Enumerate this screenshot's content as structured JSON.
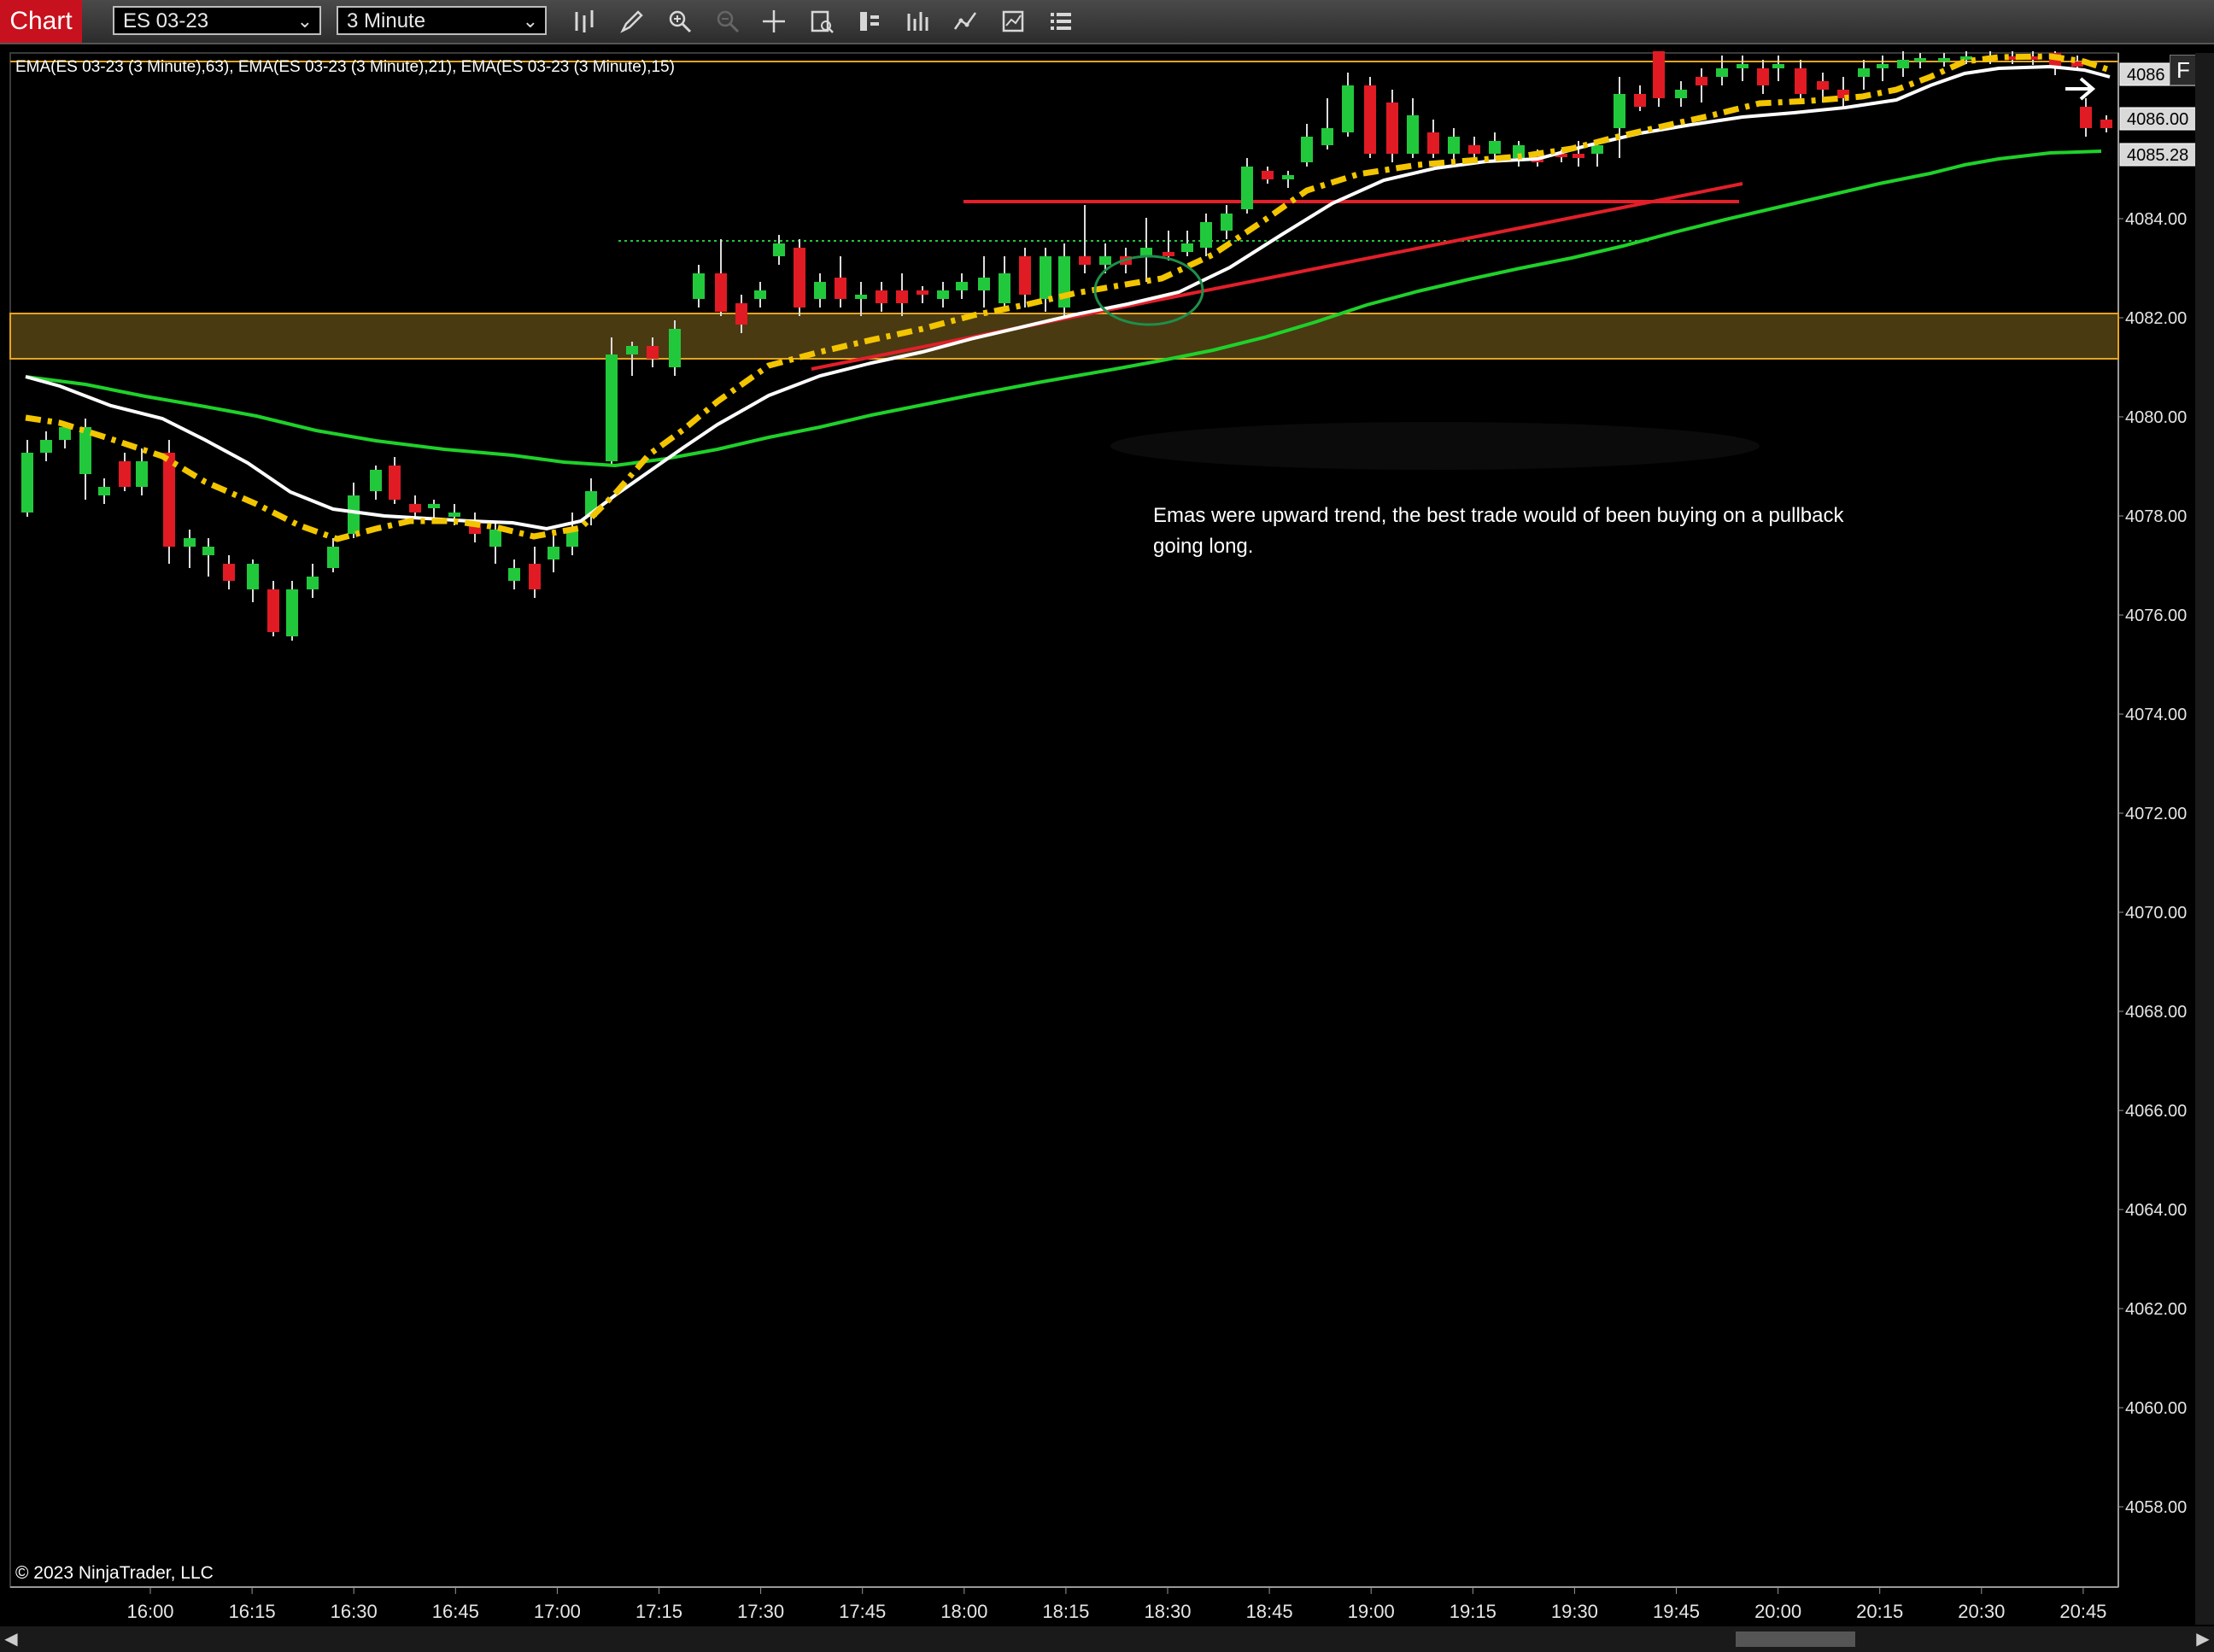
{
  "toolbar": {
    "app_title": "Chart",
    "instrument": "ES 03-23",
    "interval": "3 Minute",
    "icons": [
      "bar-type-icon",
      "draw-icon",
      "zoom-in-icon",
      "zoom-out-icon",
      "crosshair-icon",
      "data-box-icon",
      "properties-icon",
      "indicators-icon",
      "strategies-icon",
      "analyzer-icon",
      "list-icon"
    ]
  },
  "chart": {
    "indicator_label": "EMA(ES 03-23 (3 Minute),63), EMA(ES 03-23 (3 Minute),21), EMA(ES 03-23 (3 Minute),15)",
    "copyright": "© 2023 NinjaTrader, LLC",
    "note": "Emas were upward trend, the best trade would of been buying on a pullback going long.",
    "f_button": "F",
    "price_flags": [
      "4086",
      "4086.00",
      "4085.28"
    ],
    "colors": {
      "background": "#000000",
      "up_candle": "#22c83c",
      "down_candle": "#e01b24",
      "ema63": "#1fd12a",
      "ema21": "#ffffff",
      "ema15": "#f2c500",
      "trendline": "#e21f2a",
      "zone": "#4a3a12",
      "zone_border": "#e3a51f"
    }
  },
  "chart_data": {
    "type": "candlestick",
    "instrument": "ES 03-23",
    "interval": "3 Minute",
    "y_ticks": [
      "4086.00",
      "4084.00",
      "4082.00",
      "4080.00",
      "4078.00",
      "4076.00",
      "4074.00",
      "4072.00",
      "4070.00",
      "4068.00",
      "4066.00",
      "4064.00",
      "4062.00",
      "4060.00",
      "4058.00"
    ],
    "x_ticks": [
      "16:00",
      "16:15",
      "16:30",
      "16:45",
      "17:00",
      "17:15",
      "17:30",
      "17:45",
      "18:00",
      "18:15",
      "18:30",
      "18:45",
      "19:00",
      "19:15",
      "19:30",
      "19:45",
      "20:00",
      "20:15",
      "20:30",
      "20:45"
    ],
    "ylim": [
      4056.5,
      4088.2
    ],
    "series": [
      {
        "name": "EMA 63"
      },
      {
        "name": "EMA 21"
      },
      {
        "name": "EMA 15"
      }
    ],
    "horizontal_zone": [
      4081.1,
      4082.0
    ],
    "horizontal_line": 4084.3
  }
}
